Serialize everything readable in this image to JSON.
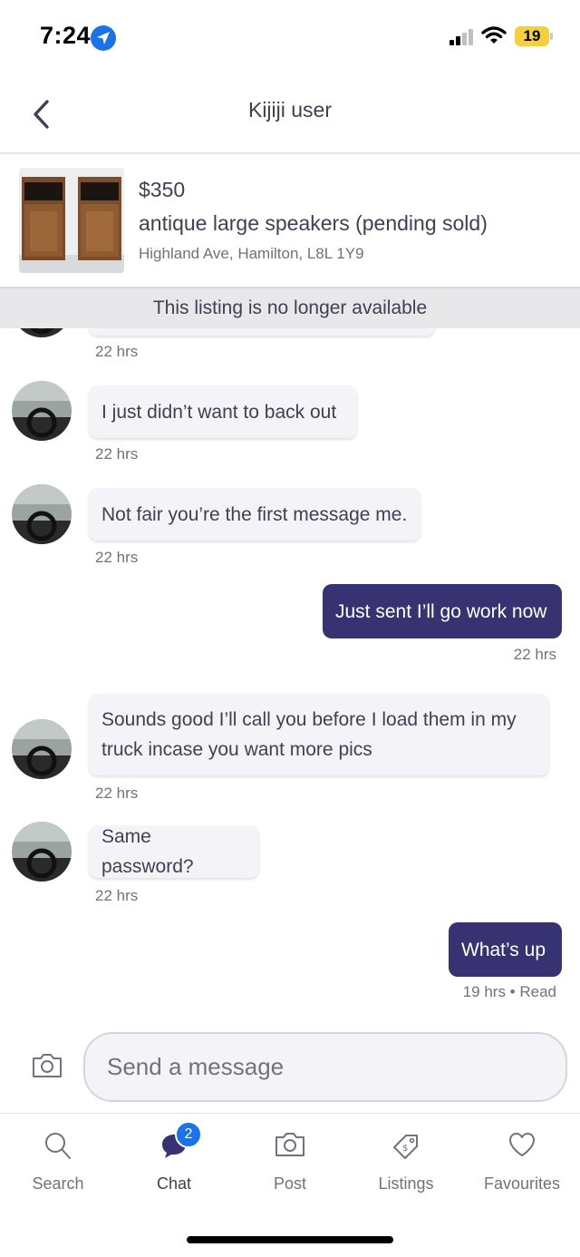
{
  "status_bar": {
    "time": "7:24",
    "battery": "19",
    "icons": [
      "location-arrow-icon",
      "cellular-signal-icon",
      "wifi-icon",
      "battery-icon"
    ]
  },
  "header": {
    "title": "Kijiji user",
    "back_icon": "chevron-left-icon"
  },
  "listing": {
    "price": "$350",
    "title": "antique large speakers (pending sold)",
    "location": "Highland Ave, Hamilton, L8L 1Y9",
    "unavailable_notice": "This listing is no longer available"
  },
  "messages": [
    {
      "direction": "in",
      "text": "",
      "time": "22 hrs"
    },
    {
      "direction": "in",
      "text": "I just didn’t want to back out",
      "time": "22 hrs"
    },
    {
      "direction": "in",
      "text": "Not fair you’re the first message me.",
      "time": "22 hrs"
    },
    {
      "direction": "out",
      "text": "Just sent I’ll go work now",
      "time": "22 hrs"
    },
    {
      "direction": "in",
      "text": "Sounds good I’ll call you before I load them in my truck incase you want more pics",
      "time": "22 hrs"
    },
    {
      "direction": "in",
      "text": "Same password?",
      "time": "22 hrs"
    },
    {
      "direction": "out",
      "text": "What’s up",
      "time": "19 hrs • Read"
    }
  ],
  "composer": {
    "placeholder": "Send a message",
    "camera_icon": "camera-icon"
  },
  "tabs": [
    {
      "label": "Search",
      "icon": "search-icon",
      "active": false
    },
    {
      "label": "Chat",
      "icon": "chat-bubble-icon",
      "active": true,
      "badge": "2"
    },
    {
      "label": "Post",
      "icon": "camera-icon",
      "active": false
    },
    {
      "label": "Listings",
      "icon": "price-tag-icon",
      "active": false
    },
    {
      "label": "Favourites",
      "icon": "heart-icon",
      "active": false
    }
  ],
  "colors": {
    "accent": "#373373",
    "text": "#3e4153",
    "muted": "#6f727f",
    "bubble_in": "#f4f4f8",
    "badge": "#1a73e8"
  }
}
